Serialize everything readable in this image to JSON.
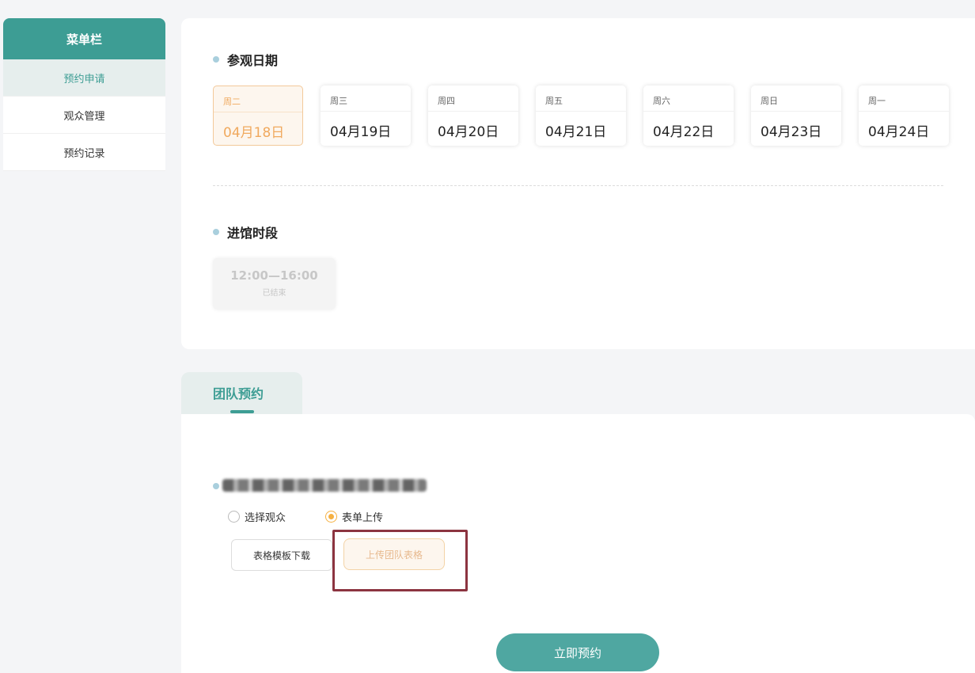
{
  "sidebar": {
    "title": "菜单栏",
    "items": [
      {
        "label": "预约申请",
        "active": true
      },
      {
        "label": "观众管理",
        "active": false
      },
      {
        "label": "预约记录",
        "active": false
      }
    ]
  },
  "visit_date": {
    "title": "参观日期",
    "dates": [
      {
        "weekday": "周二",
        "date": "04月18日",
        "selected": true
      },
      {
        "weekday": "周三",
        "date": "04月19日",
        "selected": false
      },
      {
        "weekday": "周四",
        "date": "04月20日",
        "selected": false
      },
      {
        "weekday": "周五",
        "date": "04月21日",
        "selected": false
      },
      {
        "weekday": "周六",
        "date": "04月22日",
        "selected": false
      },
      {
        "weekday": "周日",
        "date": "04月23日",
        "selected": false
      },
      {
        "weekday": "周一",
        "date": "04月24日",
        "selected": false
      }
    ]
  },
  "entry_time": {
    "title": "进馆时段",
    "slots": [
      {
        "range": "12:00—16:00",
        "status": "已结束"
      }
    ]
  },
  "tab": {
    "label": "团队预约"
  },
  "booking": {
    "options": [
      {
        "label": "选择观众",
        "checked": false
      },
      {
        "label": "表单上传",
        "checked": true
      }
    ],
    "download_template_label": "表格模板下载",
    "upload_label": "上传团队表格",
    "submit_label": "立即预约"
  },
  "colors": {
    "primary": "#3d9d94",
    "accent": "#f0a95e",
    "highlight_border": "#8c3440"
  }
}
